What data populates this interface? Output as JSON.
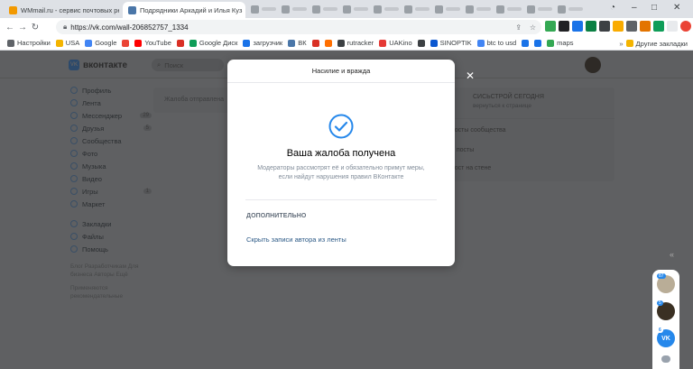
{
  "browser": {
    "tabs": [
      {
        "title": "WMmail.ru - сервис почтовых ре",
        "active": false,
        "favicon_color": "#f29900"
      },
      {
        "title": "Подрядники Аркадий и Илья Куз",
        "active": true,
        "favicon_color": "#4a76a8"
      }
    ],
    "url": "https://vk.com/wall-206852757_1334",
    "bookmarks": [
      {
        "label": "Настройки",
        "color": "#5f6368"
      },
      {
        "label": "USA",
        "color": "#f4b400"
      },
      {
        "label": "Google",
        "color": "#4285f4"
      },
      {
        "label": "",
        "color": "#ea4335"
      },
      {
        "label": "YouTube",
        "color": "#ff0000"
      },
      {
        "label": "",
        "color": "#d93025"
      },
      {
        "label": "Google Диск",
        "color": "#0f9d58"
      },
      {
        "label": "загрузчик",
        "color": "#1a73e8"
      },
      {
        "label": "ВК",
        "color": "#4a76a8"
      },
      {
        "label": "",
        "color": "#d93025"
      },
      {
        "label": "",
        "color": "#ff6f00"
      },
      {
        "label": "rutracker",
        "color": "#3c4043"
      },
      {
        "label": "UAKino",
        "color": "#e53935"
      },
      {
        "label": "",
        "color": "#3c4043"
      },
      {
        "label": "SINOPTIK",
        "color": "#0b57d0"
      },
      {
        "label": "btc to usd",
        "color": "#4285f4"
      },
      {
        "label": "",
        "color": "#1a73e8"
      },
      {
        "label": "",
        "color": "#1a73e8"
      },
      {
        "label": "maps",
        "color": "#34a853"
      }
    ],
    "other_bookmarks": "Другие закладки"
  },
  "vk": {
    "logo_text": "вконтакте",
    "search_placeholder": "Поиск",
    "sidebar": [
      {
        "label": "Профиль",
        "count": ""
      },
      {
        "label": "Лента",
        "count": ""
      },
      {
        "label": "Мессенджер",
        "count": "29"
      },
      {
        "label": "Друзья",
        "count": "5"
      },
      {
        "label": "Сообщества",
        "count": ""
      },
      {
        "label": "Фото",
        "count": ""
      },
      {
        "label": "Музыка",
        "count": ""
      },
      {
        "label": "Видео",
        "count": ""
      },
      {
        "label": "Игры",
        "count": "1"
      },
      {
        "label": "Маркет",
        "count": ""
      }
    ],
    "sidebar2": [
      {
        "label": "Закладки"
      },
      {
        "label": "Файлы"
      },
      {
        "label": "Помощь"
      }
    ],
    "footer": "Блог  Разработчикам  Для бизнеса  Авторы  Ещё",
    "footer2": "Применяются рекомендательные",
    "post_notice": "Жалоба отправлена",
    "right_card": {
      "title": "СИСЬСТРОЙ СЕГОДНЯ",
      "subtitle": "вернуться к странице",
      "lines": [
        "посты сообщества",
        "и посты",
        "пост на стене"
      ]
    }
  },
  "modal": {
    "header": "Насилие и вражда",
    "title": "Ваша жалоба получена",
    "text": "Модераторы рассмотрят её и обязательно примут меры, если найдут нарушения правил ВКонтакте",
    "section": "ДОПОЛНИТЕЛЬНО",
    "link": "Скрыть записи автора из ленты",
    "accent": "#2a5885",
    "check_color": "#2688eb"
  },
  "floating": {
    "badges": [
      "87",
      "5",
      "6"
    ]
  }
}
